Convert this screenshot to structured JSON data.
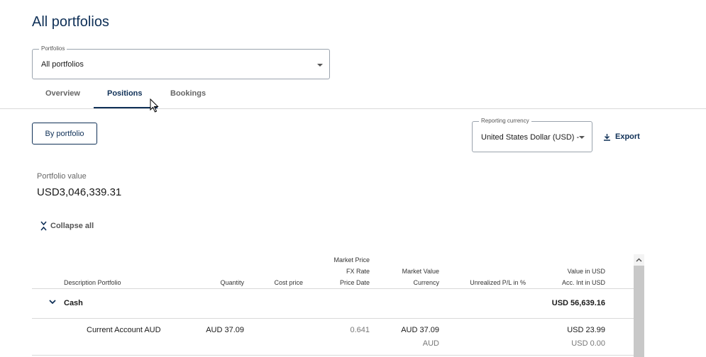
{
  "page": {
    "title": "All portfolios"
  },
  "portfolio_select": {
    "label": "Portfolios",
    "value": "All portfolios"
  },
  "tabs": [
    {
      "label": "Overview"
    },
    {
      "label": "Positions",
      "active": true
    },
    {
      "label": "Bookings"
    }
  ],
  "toolbar": {
    "by_portfolio_label": "By portfolio",
    "reporting_currency_label": "Reporting currency",
    "reporting_currency_value": "United States Dollar (USD) -",
    "export_label": "Export"
  },
  "portfolio_value": {
    "label": "Portfolio value",
    "value": "USD3,046,339.31"
  },
  "collapse_label": "Collapse all",
  "table": {
    "headers": {
      "description": "Description Portfolio",
      "quantity": "Quantity",
      "cost_price": "Cost price",
      "market_price": "Market Price",
      "fx_rate": "FX Rate",
      "price_date": "Price Date",
      "market_value": "Market Value",
      "currency": "Currency",
      "unrealized": "Unrealized P/L in %",
      "value_usd": "Value in USD",
      "acc_int": "Acc. Int in USD"
    },
    "groups": [
      {
        "name": "Cash",
        "total": "USD 56,639.16",
        "rows": [
          {
            "description": "Current Account AUD",
            "quantity": "AUD 37.09",
            "fx_rate": "0.641",
            "market_value": "AUD 37.09",
            "currency": "AUD",
            "value_usd": "USD 23.99",
            "acc_int": "USD 0.00"
          }
        ]
      }
    ]
  },
  "colors": {
    "primary": "#0f3057",
    "divider": "#d9d9d9"
  },
  "icons": [
    "chevron-down-icon",
    "download-icon",
    "collapse-icon",
    "chevron-up-icon",
    "mouse-cursor-icon"
  ]
}
